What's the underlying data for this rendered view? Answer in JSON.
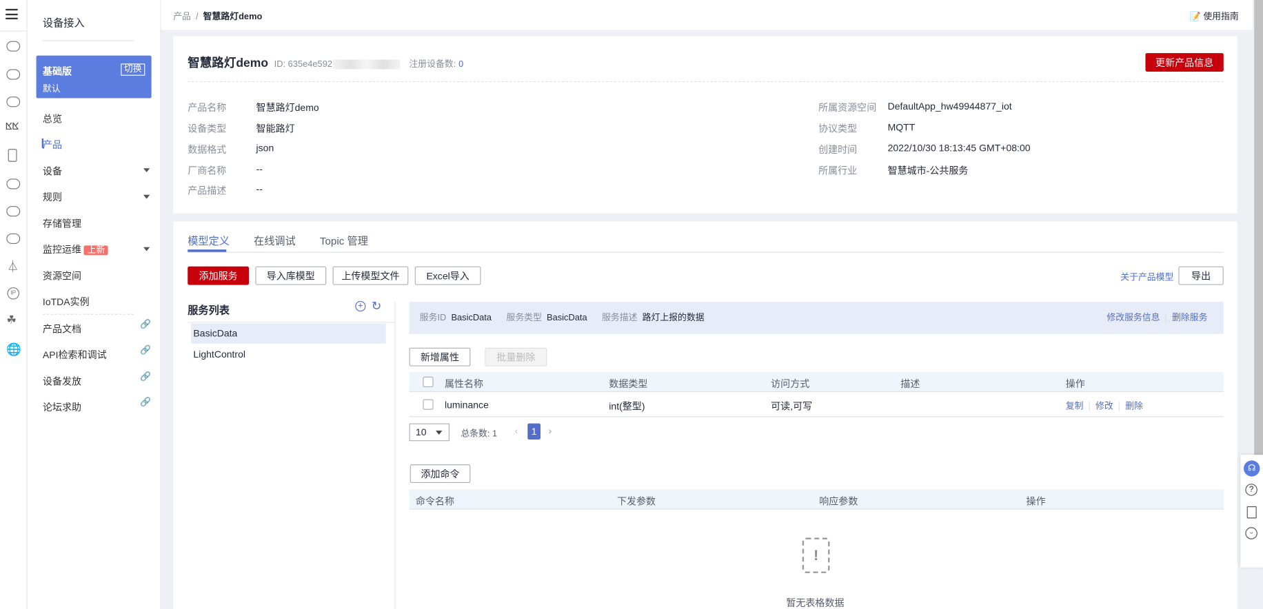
{
  "rail": {
    "icons": [
      "menu-icon",
      "cloud-device-icon",
      "cloud-chat-icon",
      "cloud-storage-icon",
      "wave-icon",
      "phone-cloud-icon",
      "cloud-icon",
      "cloud-upload-icon",
      "cloud-speed-icon",
      "antenna-icon",
      "ip-icon",
      "cluster-icon",
      "globe-icon"
    ]
  },
  "sidebar": {
    "title": "设备接入",
    "edition": {
      "name": "基础版",
      "sub": "默认",
      "switch": "切换"
    },
    "items": [
      {
        "label": "总览"
      },
      {
        "label": "产品",
        "active": true
      },
      {
        "label": "设备"
      },
      {
        "label": "规则"
      },
      {
        "label": "存储管理"
      },
      {
        "label": "监控运维",
        "badge": "上新"
      },
      {
        "label": "资源空间"
      },
      {
        "label": "IoTDA实例"
      }
    ],
    "links": [
      {
        "label": "产品文档"
      },
      {
        "label": "API检索和调试"
      },
      {
        "label": "设备发放"
      },
      {
        "label": "论坛求助"
      }
    ]
  },
  "topbar": {
    "breadcrumb_root": "产品",
    "breadcrumb_sep": "/",
    "breadcrumb_current": "智慧路灯demo",
    "guide": "使用指南"
  },
  "product": {
    "title": "智慧路灯demo",
    "id_label": "ID: 635e4e592",
    "devices_label": "注册设备数:",
    "devices_count": "0",
    "update_button": "更新产品信息",
    "left": [
      {
        "label": "产品名称",
        "value": "智慧路灯demo"
      },
      {
        "label": "设备类型",
        "value": "智能路灯"
      },
      {
        "label": "数据格式",
        "value": "json"
      },
      {
        "label": "厂商名称",
        "value": "--"
      },
      {
        "label": "产品描述",
        "value": "--"
      }
    ],
    "right": [
      {
        "label": "所属资源空间",
        "value": "DefaultApp_hw49944877_iot"
      },
      {
        "label": "协议类型",
        "value": "MQTT"
      },
      {
        "label": "创建时间",
        "value": "2022/10/30 18:13:45 GMT+08:00"
      },
      {
        "label": "所属行业",
        "value": "智慧城市-公共服务"
      }
    ]
  },
  "tabs": [
    {
      "label": "模型定义",
      "active": true
    },
    {
      "label": "在线调试"
    },
    {
      "label": "Topic 管理"
    }
  ],
  "toolbar": {
    "add_service": "添加服务",
    "import_lib": "导入库模型",
    "upload_model": "上传模型文件",
    "excel_import": "Excel导入",
    "about_model": "关于产品模型",
    "export": "导出"
  },
  "services": {
    "title": "服务列表",
    "items": [
      "BasicData",
      "LightControl"
    ]
  },
  "service_info": {
    "id_label": "服务ID",
    "id": "BasicData",
    "type_label": "服务类型",
    "type": "BasicData",
    "desc_label": "服务描述",
    "desc": "路灯上报的数据",
    "edit": "修改服务信息",
    "delete": "删除服务"
  },
  "properties": {
    "add": "新增属性",
    "batch_delete": "批量删除",
    "headers": [
      "属性名称",
      "数据类型",
      "访问方式",
      "描述",
      "操作"
    ],
    "rows": [
      {
        "name": "luminance",
        "type": "int(整型)",
        "access": "可读,可写",
        "desc": "",
        "ops": [
          "复制",
          "修改",
          "删除"
        ]
      }
    ],
    "page_size": "10",
    "total_label": "总条数:",
    "total": "1",
    "page": "1"
  },
  "commands": {
    "add": "添加命令",
    "headers": [
      "命令名称",
      "下发参数",
      "响应参数",
      "操作"
    ],
    "empty": "暂无表格数据"
  },
  "float_tools": [
    "headset-icon",
    "help-icon",
    "feedback-icon",
    "smile-icon"
  ]
}
